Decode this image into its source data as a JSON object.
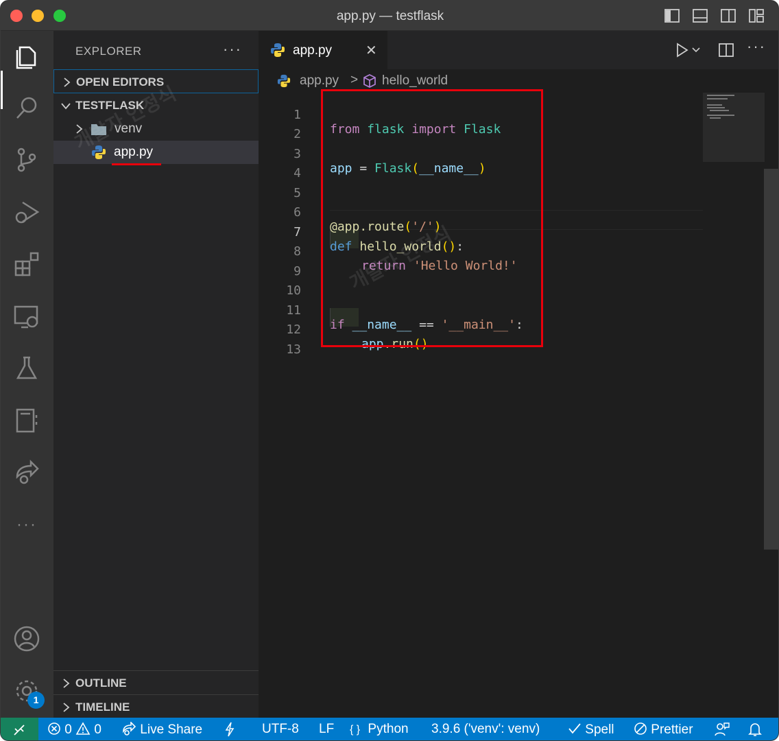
{
  "window": {
    "title": "app.py — testflask"
  },
  "sidebar": {
    "title": "EXPLORER",
    "more": "···",
    "sections": {
      "open_editors": "OPEN EDITORS",
      "project": "TESTFLASK",
      "outline": "OUTLINE",
      "timeline": "TIMELINE"
    },
    "tree": {
      "folder": "venv",
      "file": "app.py"
    }
  },
  "activity": {
    "badge": "1",
    "more": "···"
  },
  "tab": {
    "name": "app.py",
    "close": "✕"
  },
  "breadcrumb": {
    "file": "app.py",
    "separator": ">",
    "symbol": "hello_world"
  },
  "editor": {
    "line_numbers": [
      "1",
      "2",
      "3",
      "4",
      "5",
      "6",
      "7",
      "8",
      "9",
      "10",
      "11",
      "12",
      "13"
    ],
    "current_line": 7
  },
  "code": {
    "l1": {
      "t1": "from",
      "t2": "flask",
      "t3": "import",
      "t4": "Flask"
    },
    "l3": {
      "t1": "app",
      "t2": " = ",
      "t3": "Flask",
      "t4": "(",
      "t5": "__name__",
      "t6": ")"
    },
    "l6": {
      "t1": "@app",
      "t2": ".route",
      "t3": "(",
      "t4": "'/'",
      "t5": ")"
    },
    "l7": {
      "t1": "def",
      "t2": "hello_world",
      "t3": "()",
      "t4": ":"
    },
    "l8": {
      "t1": "return",
      "t2": "'Hello World!'"
    },
    "l11": {
      "t1": "if",
      "t2": "__name__",
      "t3": " == ",
      "t4": "'__main__'",
      "t5": ":"
    },
    "l12": {
      "t1": "app",
      "t2": ".run",
      "t3": "()"
    }
  },
  "watermark": "개발자 인정식",
  "status": {
    "errors": "0",
    "warnings": "0",
    "live_share": "Live Share",
    "encoding": "UTF-8",
    "eol": "LF",
    "language_icon": "{ }",
    "language": "Python",
    "interpreter": "3.9.6 ('venv': venv)",
    "spell": "Spell",
    "prettier": "Prettier"
  },
  "colors": {
    "accent": "#007acc",
    "remote": "#16825d",
    "highlight_box": "#e8000b"
  }
}
